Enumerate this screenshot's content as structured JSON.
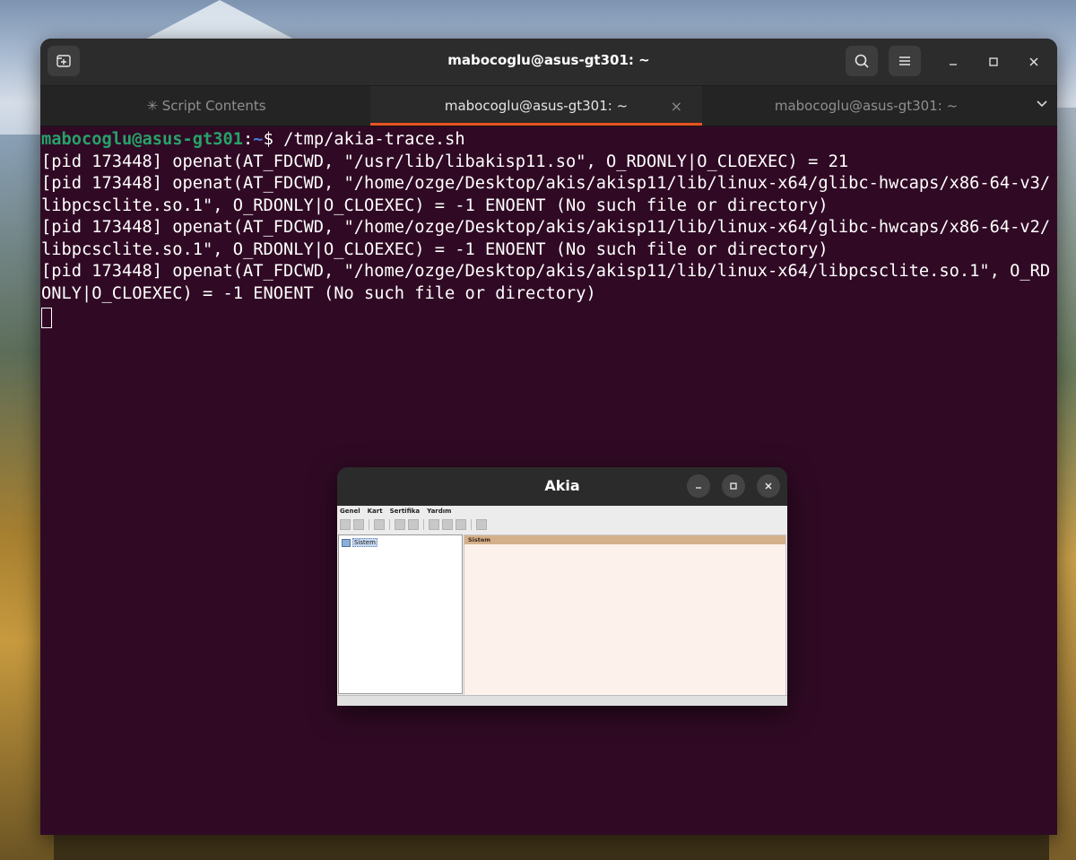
{
  "terminal": {
    "window_title": "mabocoglu@asus-gt301: ~",
    "tabs": [
      {
        "label": "✳ Script Contents",
        "active": false
      },
      {
        "label": "mabocoglu@asus-gt301: ~",
        "active": true
      },
      {
        "label": "mabocoglu@asus-gt301: ~",
        "active": false
      }
    ],
    "prompt": {
      "user_host": "mabocoglu@asus-gt301",
      "colon": ":",
      "path": "~",
      "symbol": "$ ",
      "command": "/tmp/akia-trace.sh"
    },
    "output_lines": [
      "[pid 173448] openat(AT_FDCWD, \"/usr/lib/libakisp11.so\", O_RDONLY|O_CLOEXEC) = 21",
      "[pid 173448] openat(AT_FDCWD, \"/home/ozge/Desktop/akis/akisp11/lib/linux-x64/glibc-hwcaps/x86-64-v3/",
      "libpcsclite.so.1\", O_RDONLY|O_CLOEXEC) = -1 ENOENT (No such file or directory)",
      "[pid 173448] openat(AT_FDCWD, \"/home/ozge/Desktop/akis/akisp11/lib/linux-x64/glibc-hwcaps/x86-64-v2/",
      "libpcsclite.so.1\", O_RDONLY|O_CLOEXEC) = -1 ENOENT (No such file or directory)",
      "[pid 173448] openat(AT_FDCWD, \"/home/ozge/Desktop/akis/akisp11/lib/linux-x64/libpcsclite.so.1\", O_RD",
      "ONLY|O_CLOEXEC) = -1 ENOENT (No such file or directory)"
    ],
    "icons": {
      "new_tab": "new-tab-icon",
      "search": "search-icon",
      "menu": "hamburger-menu-icon",
      "minimize": "minimize-icon",
      "maximize": "maximize-icon",
      "close": "close-icon",
      "tab_close": "×",
      "tab_overflow": "chevron-down-icon"
    },
    "colors": {
      "background": "#300a24",
      "prompt_user": "#26a269",
      "prompt_path": "#4a7bd8",
      "tab_accent": "#e95420"
    }
  },
  "akia": {
    "title": "Akia",
    "menu": [
      "Genel",
      "Kart",
      "Sertifika",
      "Yardım"
    ],
    "tree_items": [
      "Sistem"
    ],
    "panel_header": "Sistem"
  }
}
